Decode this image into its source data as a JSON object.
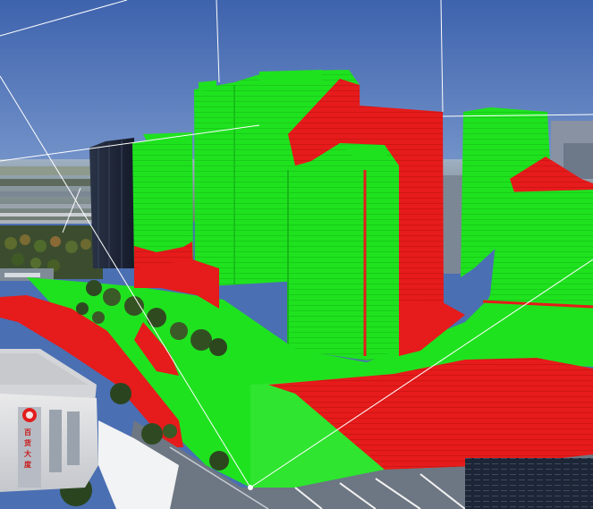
{
  "scene": {
    "view": "3d-city-visibility-analysis",
    "legend": {
      "visible_color": "#1fe21f",
      "invisible_color": "#e61b1b"
    },
    "colors": {
      "sky_top": "#3e63ad",
      "sky_bottom": "#6f93c9",
      "visible_green": "#1fe21f",
      "invisible_red": "#e61b1b",
      "sight_line": "#ffffff",
      "road": "#6d7683",
      "dark_tower": "#1b2233",
      "glass_tower": "#7c8796"
    },
    "storefront_sign": {
      "logo": "circle-logo",
      "lettering": "百货大度"
    }
  }
}
